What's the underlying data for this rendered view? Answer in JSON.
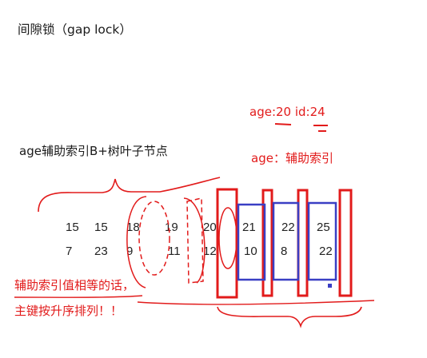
{
  "title": "间隙锁（gap lock）",
  "subtitle": "age辅助索引B+树叶子节点",
  "annotation_age_id": "age:20  id:24",
  "annotation_age_index": "age：辅助索引",
  "note_line1": "辅助索引值相等的话，",
  "note_line2": "主键按升序排列！！",
  "keys_row": [
    "15",
    "15",
    "18",
    "19",
    "20",
    "21",
    "22",
    "25"
  ],
  "ids_row": [
    "7",
    "23",
    "9",
    "11",
    "12",
    "10",
    "8",
    "22"
  ],
  "colors": {
    "annotation": "#e21b1b",
    "page_box": "#3a3fc4",
    "text": "#1a1a1a"
  }
}
